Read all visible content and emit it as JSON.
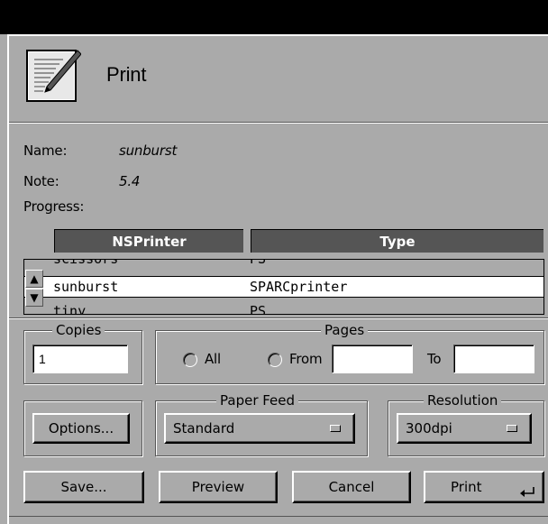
{
  "window": {
    "title": "Print"
  },
  "info": {
    "name_label": "Name:",
    "name_value": "sunburst",
    "note_label": "Note:",
    "note_value": "5.4",
    "progress_label": "Progress:"
  },
  "printers": {
    "columns": [
      "NSPrinter",
      "Type"
    ],
    "rows": [
      {
        "name": "scissors",
        "type": "PS"
      },
      {
        "name": "sunburst",
        "type": "SPARCprinter"
      },
      {
        "name": "tiny",
        "type": "PS"
      }
    ]
  },
  "copies": {
    "label": "Copies",
    "value": "1"
  },
  "pages": {
    "label": "Pages",
    "all_label": "All",
    "from_label": "From",
    "to_label": "To",
    "from_value": "",
    "to_value": ""
  },
  "options": {
    "label": "Options..."
  },
  "paper_feed": {
    "label": "Paper Feed",
    "value": "Standard"
  },
  "resolution": {
    "label": "Resolution",
    "value": "300dpi"
  },
  "actions": {
    "save": "Save...",
    "preview": "Preview",
    "cancel": "Cancel",
    "print": "Print"
  }
}
